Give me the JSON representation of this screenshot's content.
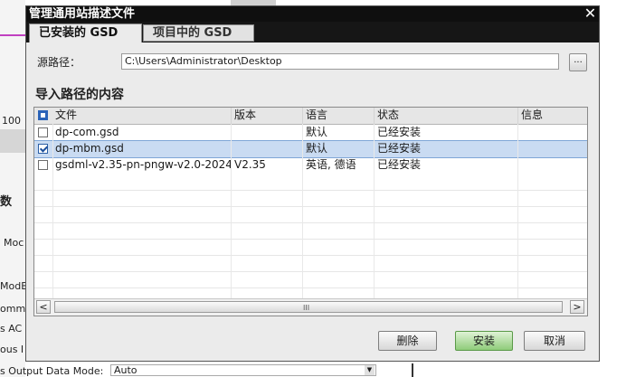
{
  "background": {
    "left_fragments": [
      "100",
      "数",
      "Moc",
      "ModB",
      "omm",
      "s AC",
      "ous I"
    ],
    "bottom_label": "s Output Data Mode:",
    "bottom_value": "Auto",
    "bottom_dropdown_icon": "dropdown-arrow-icon"
  },
  "dialog": {
    "title": "管理通用站描述文件",
    "close_label": "✕",
    "tabs": [
      {
        "label": "已安装的 GSD",
        "active": true
      },
      {
        "label": "项目中的 GSD",
        "active": false
      }
    ],
    "source_label": "源路径：",
    "source_path": "C:\\Users\\Administrator\\Desktop",
    "browse_label": "...",
    "section_title": "导入路径的内容",
    "table": {
      "columns": [
        "文件",
        "版本",
        "语言",
        "状态",
        "信息"
      ],
      "rows": [
        {
          "checked": false,
          "selected": false,
          "file": "dp-com.gsd",
          "version": "",
          "language": "默认",
          "status": "已经安装",
          "info": ""
        },
        {
          "checked": true,
          "selected": true,
          "file": "dp-mbm.gsd",
          "version": "",
          "language": "默认",
          "status": "已经安装",
          "info": ""
        },
        {
          "checked": false,
          "selected": false,
          "file": "gsdml-v2.35-pn-pngw-v2.0-2024...",
          "version": "V2.35",
          "language": "英语, 德语",
          "status": "已经安装",
          "info": ""
        }
      ]
    },
    "scroll_grip": "III",
    "buttons": {
      "delete": "删除",
      "install": "安装",
      "cancel": "取消"
    },
    "colors": {
      "titlebar": "#0f0f0f",
      "selected_row": "#c9dbf2",
      "install_button": "#8fcc7a"
    }
  }
}
